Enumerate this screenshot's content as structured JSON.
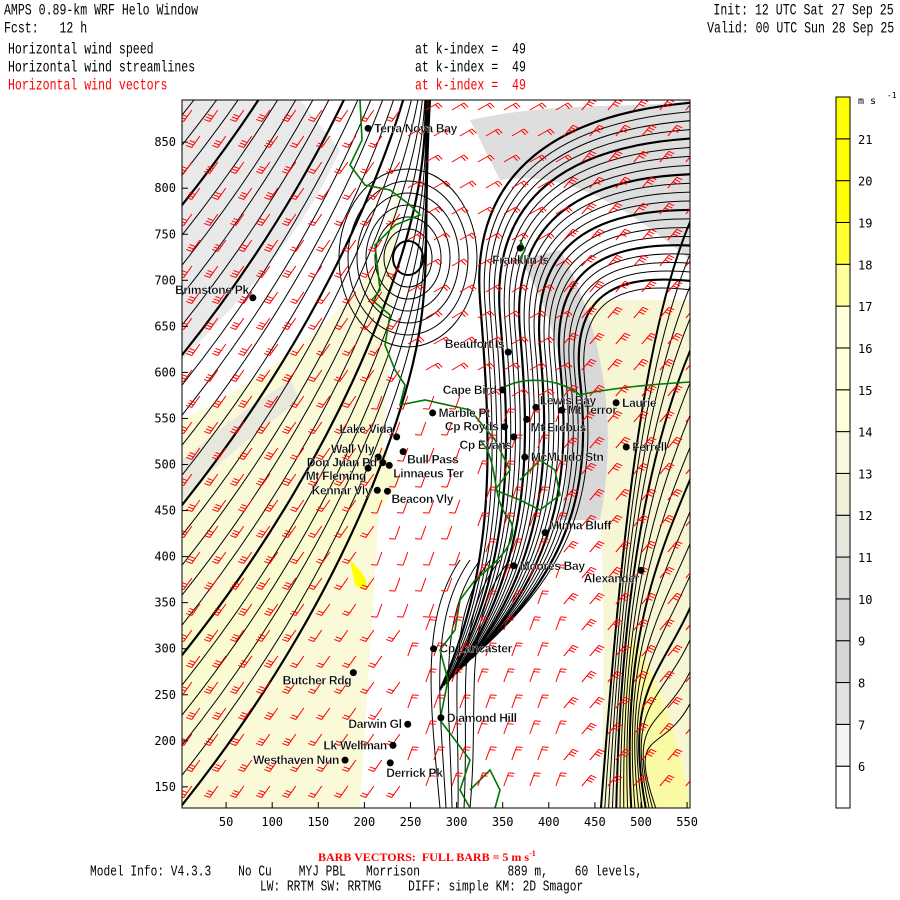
{
  "header": {
    "title": "AMPS 0.89-km WRF Helo Window",
    "forecast": "Fcst:   12 h",
    "init": "Init: 12 UTC Sat 27 Sep 25",
    "valid": "Valid: 00 UTC Sun 28 Sep 25",
    "fields": [
      {
        "name": "Horizontal wind speed",
        "level": "at k-index =  49",
        "color": "#000000"
      },
      {
        "name": "Horizontal wind streamlines",
        "level": "at k-index =  49",
        "color": "#000000"
      },
      {
        "name": "Horizontal wind vectors",
        "level": "at k-index =  49",
        "color": "#ff0000"
      }
    ]
  },
  "chart_data": {
    "type": "map",
    "x_ticks": [
      50,
      100,
      150,
      200,
      250,
      300,
      350,
      400,
      450,
      500,
      550
    ],
    "y_ticks": [
      150,
      200,
      250,
      300,
      350,
      400,
      450,
      500,
      550,
      600,
      650,
      700,
      750,
      800,
      850
    ],
    "xlim": [
      0,
      552
    ],
    "ylim": [
      127,
      896
    ],
    "stations": [
      {
        "name": "Terra Nova Bay",
        "x": 204,
        "y": 865,
        "side": "right"
      },
      {
        "name": "Franklin Is",
        "x": 369,
        "y": 735,
        "side": "below-left"
      },
      {
        "name": "Brimstone Pk",
        "x": 79,
        "y": 681,
        "side": "left-up"
      },
      {
        "name": "Beaufort Is",
        "x": 356,
        "y": 622,
        "side": "left-up"
      },
      {
        "name": "Cape Bird",
        "x": 350,
        "y": 581,
        "side": "left"
      },
      {
        "name": "Marble Pt",
        "x": 274,
        "y": 556,
        "side": "right"
      },
      {
        "name": "Lewis Bay",
        "x": 386,
        "y": 562,
        "side": "right-up"
      },
      {
        "name": "Mt Terror",
        "x": 414,
        "y": 559,
        "side": "right"
      },
      {
        "name": "Laurie",
        "x": 473,
        "y": 567,
        "side": "right"
      },
      {
        "name": "Cp Royds",
        "x": 352,
        "y": 541,
        "side": "left"
      },
      {
        "name": "Mt Erebus",
        "x": 376,
        "y": 549,
        "side": "right-down"
      },
      {
        "name": "Cp Evans",
        "x": 362,
        "y": 530,
        "side": "left-down"
      },
      {
        "name": "Lake Vida",
        "x": 235,
        "y": 530,
        "side": "left-up"
      },
      {
        "name": "Wall Vly",
        "x": 215,
        "y": 508,
        "side": "left-up"
      },
      {
        "name": "Bull Pass",
        "x": 242,
        "y": 514,
        "side": "right-down"
      },
      {
        "name": "Don Juan Pd",
        "x": 220,
        "y": 502,
        "side": "left"
      },
      {
        "name": "Mt Fleming",
        "x": 204,
        "y": 496,
        "side": "left-down"
      },
      {
        "name": "McMurdo Stn",
        "x": 374,
        "y": 508,
        "side": "right"
      },
      {
        "name": "Ferrell",
        "x": 484,
        "y": 519,
        "side": "right"
      },
      {
        "name": "Linnaeus Ter",
        "x": 227,
        "y": 499,
        "side": "right-down"
      },
      {
        "name": "Kennar Vly",
        "x": 214,
        "y": 472,
        "side": "left"
      },
      {
        "name": "Beacon Vly",
        "x": 225,
        "y": 471,
        "side": "right-down"
      },
      {
        "name": "Minna Bluff",
        "x": 396,
        "y": 426,
        "side": "right-up"
      },
      {
        "name": "Moores Bay",
        "x": 362,
        "y": 390,
        "side": "right"
      },
      {
        "name": "Alexander",
        "x": 500,
        "y": 385,
        "side": "left-down"
      },
      {
        "name": "Cp Lancaster",
        "x": 275,
        "y": 300,
        "side": "right"
      },
      {
        "name": "Butcher Rdg",
        "x": 188,
        "y": 274,
        "side": "left-down"
      },
      {
        "name": "Diamond Hill",
        "x": 283,
        "y": 225,
        "side": "right"
      },
      {
        "name": "Darwin Gl",
        "x": 247,
        "y": 218,
        "side": "left"
      },
      {
        "name": "Lk Wellman",
        "x": 231,
        "y": 195,
        "side": "left"
      },
      {
        "name": "Westhaven Nun",
        "x": 179,
        "y": 179,
        "side": "left"
      },
      {
        "name": "Derrick Pk",
        "x": 228,
        "y": 176,
        "side": "below"
      }
    ],
    "colorbar": {
      "units": "m s",
      "units_exp": "-1",
      "levels": [
        6,
        7,
        8,
        9,
        10,
        11,
        12,
        13,
        14,
        15,
        16,
        17,
        18,
        19,
        20,
        21
      ],
      "colors": [
        "#ffffff",
        "#f4f4f4",
        "#e2e2e2",
        "#d6d6d6",
        "#d6d6d6",
        "#dcdcd8",
        "#e6e6dc",
        "#f0f0d8",
        "#f8f8e0",
        "#ffffdc",
        "#ffffdc",
        "#ffffdc",
        "#ffff99",
        "#ffff33",
        "#ffff00",
        "#ffff00",
        "#ffff00"
      ]
    },
    "coastline_color": "#007700",
    "barb_color": "#ff0000"
  },
  "footer": {
    "barb_note": "BARB VECTORS:  FULL BARB = 5 m s",
    "barb_note_exp": "-1",
    "model_info": "Model Info: V4.3.3    No Cu    MYJ PBL   Morrison             889 m,    60 levels,",
    "physics": "LW: RRTM SW: RRTMG    DIFF: simple KM: 2D Smagor"
  }
}
